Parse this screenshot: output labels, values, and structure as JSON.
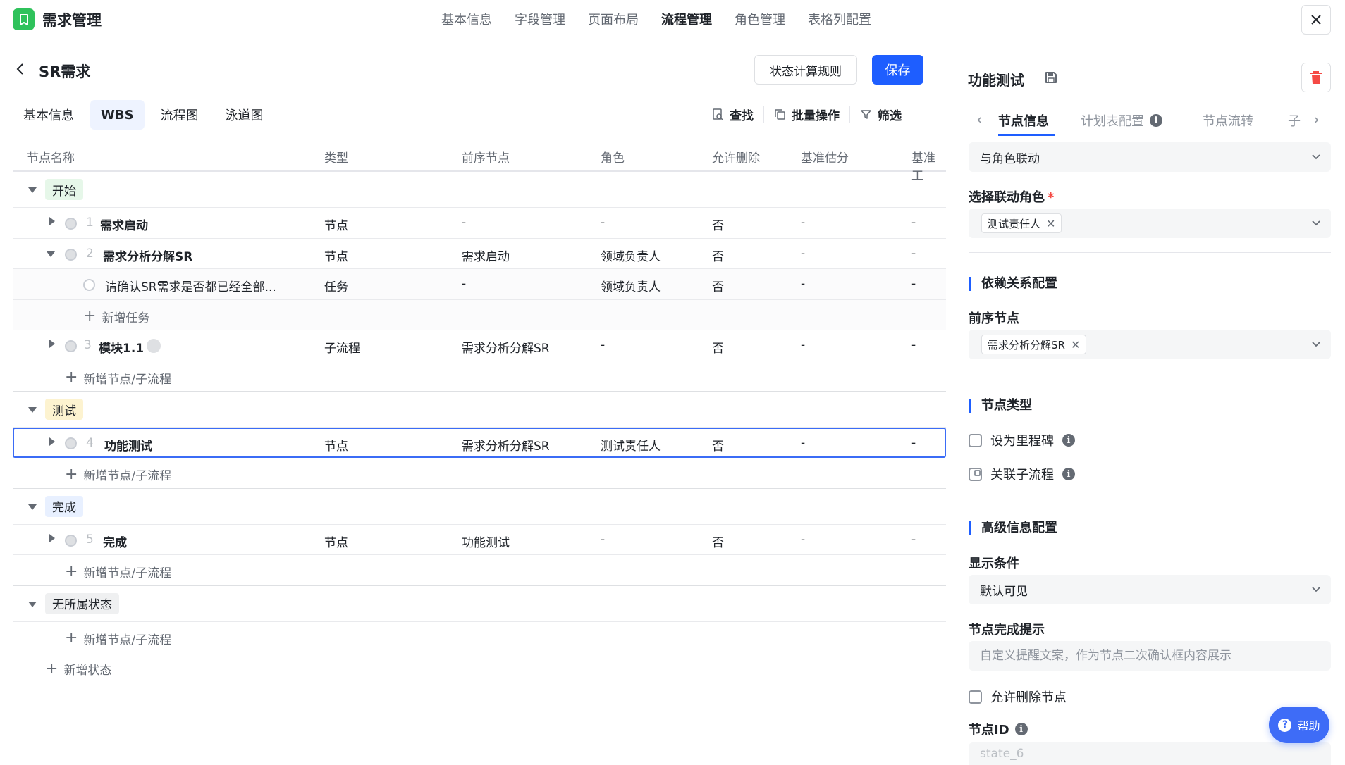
{
  "app": {
    "title": "需求管理"
  },
  "topnav": [
    "基本信息",
    "字段管理",
    "页面布局",
    "流程管理",
    "角色管理",
    "表格列配置"
  ],
  "topnav_active": "流程管理",
  "page": {
    "title": "SR需求",
    "rule_button": "状态计算规则",
    "save_button": "保存"
  },
  "subtabs": [
    "基本信息",
    "WBS",
    "流程图",
    "泳道图"
  ],
  "subtab_active": "WBS",
  "toolbar": {
    "search": "查找",
    "batch": "批量操作",
    "filter": "筛选"
  },
  "table": {
    "columns": [
      "节点名称",
      "类型",
      "前序节点",
      "角色",
      "允许删除",
      "基准估分",
      "基准工"
    ],
    "groups": {
      "start": {
        "label": "开始",
        "color": "#e6f7e9"
      },
      "test": {
        "label": "测试",
        "color": "#fdf3d0"
      },
      "done": {
        "label": "完成",
        "color": "#e8f0ff"
      },
      "none": {
        "label": "无所属状态",
        "color": "#eff0f1"
      }
    },
    "rows": [
      {
        "num": "1",
        "name": "需求启动",
        "type": "节点",
        "prev": "-",
        "role": "-",
        "del": "否",
        "est": "-",
        "base": "-"
      },
      {
        "num": "2",
        "name": "需求分析分解SR",
        "type": "节点",
        "prev": "需求启动",
        "role": "领域负责人",
        "del": "否",
        "est": "-",
        "base": "-"
      },
      {
        "num": "",
        "name": "请确认SR需求是否都已经全部...",
        "type": "任务",
        "prev": "-",
        "role": "领域负责人",
        "del": "否",
        "est": "-",
        "base": "-"
      },
      {
        "num": "3",
        "name": "模块1.1",
        "type": "子流程",
        "prev": "需求分析分解SR",
        "role": "-",
        "del": "否",
        "est": "-",
        "base": "-"
      },
      {
        "num": "4",
        "name": "功能测试",
        "type": "节点",
        "prev": "需求分析分解SR",
        "role": "测试责任人",
        "del": "否",
        "est": "-",
        "base": "-"
      },
      {
        "num": "5",
        "name": "完成",
        "type": "节点",
        "prev": "功能测试",
        "role": "-",
        "del": "否",
        "est": "-",
        "base": "-"
      }
    ],
    "add_task": "新增任务",
    "add_node": "新增节点/子流程",
    "add_state": "新增状态"
  },
  "panel": {
    "title": "功能测试",
    "tabs": [
      "节点信息",
      "计划表配置",
      "节点流转",
      "子"
    ],
    "tab_active": "节点信息",
    "link_select": "与角色联动",
    "role_label": "选择联动角色",
    "role_chip": "测试责任人",
    "dep_section": "依赖关系配置",
    "prev_label": "前序节点",
    "prev_chip": "需求分析分解SR",
    "type_section": "节点类型",
    "milestone": "设为里程碑",
    "link_subflow": "关联子流程",
    "adv_section": "高级信息配置",
    "display_label": "显示条件",
    "display_value": "默认可见",
    "hint_label": "节点完成提示",
    "hint_placeholder": "自定义提醒文案，作为节点二次确认框内容展示",
    "allow_delete": "允许删除节点",
    "id_label": "节点ID",
    "id_value": "state_6",
    "help": "帮助"
  },
  "colors": {
    "accent": "#1e5eff",
    "logo": "#2fc25b",
    "danger": "#f54a45"
  }
}
